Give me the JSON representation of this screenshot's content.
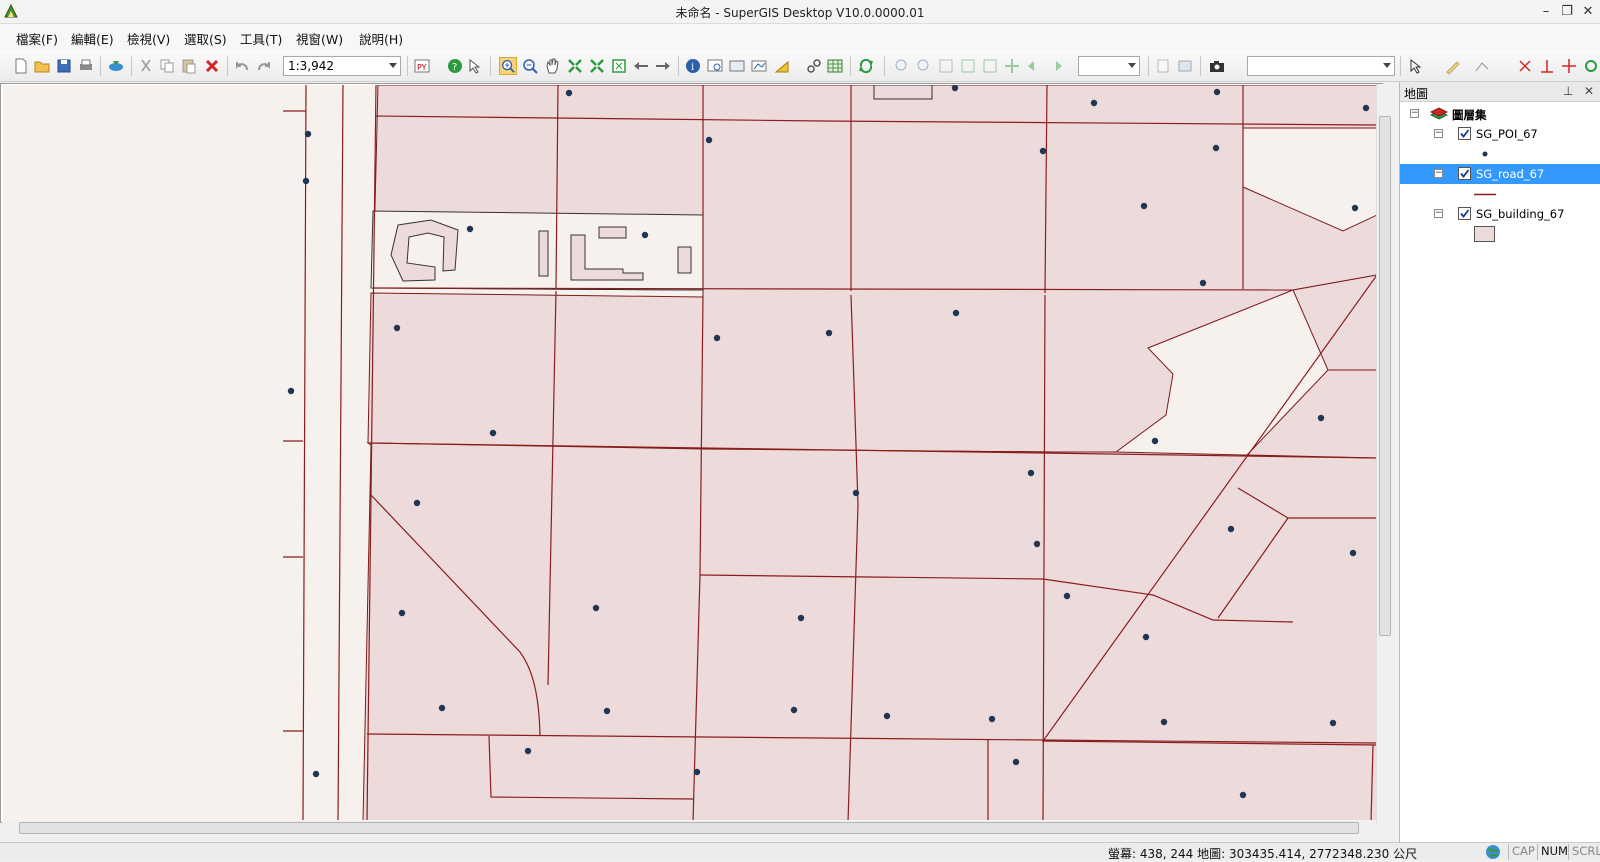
{
  "window": {
    "title": "未命名 - SuperGIS Desktop V10.0.0000.01"
  },
  "menu": [
    "檔案(F)",
    "編輯(E)",
    "檢視(V)",
    "選取(S)",
    "工具(T)",
    "視窗(W)",
    "說明(H)"
  ],
  "toolbar": {
    "scale": "1:3,942",
    "layer_combo": "",
    "target_combo": ""
  },
  "panel": {
    "title": "地圖",
    "root_label": "圖層集",
    "layers": [
      {
        "name": "SG_POI_67",
        "checked": true,
        "selected": false,
        "symbol": "point"
      },
      {
        "name": "SG_road_67",
        "checked": true,
        "selected": true,
        "symbol": "line"
      },
      {
        "name": "SG_building_67",
        "checked": true,
        "selected": false,
        "symbol": "polygon"
      }
    ]
  },
  "status": {
    "coords": "螢幕: 438, 244  地圖: 303435.414, 2772348.230 公尺",
    "keys": [
      "CAP",
      "NUM",
      "SCRL"
    ],
    "active_keys": [
      "NUM"
    ]
  },
  "colors": {
    "map_background": "#f7f1ed",
    "block_fill": "#eddadb",
    "road": "#8b1d1d",
    "poi": "#1f3552",
    "selection": "#3399ff"
  },
  "icons": {
    "app": "supergis-app-icon",
    "toolbar": [
      "new-icon",
      "open-icon",
      "save-icon",
      "print-icon",
      "add-data-icon",
      "cut-icon",
      "copy-icon",
      "paste-icon",
      "delete-icon",
      "undo-icon",
      "redo-icon",
      "python-icon",
      "help-icon",
      "whats-this-icon",
      "zoom-in-icon",
      "zoom-out-icon",
      "pan-icon",
      "fixed-zoom-in-icon",
      "fixed-zoom-out-icon",
      "full-extent-icon",
      "back-icon",
      "forward-icon",
      "identify-icon",
      "find-icon",
      "hyperlink-icon",
      "measure-icon",
      "draw-icon",
      "link-icon",
      "table-icon",
      "refresh-icon"
    ]
  }
}
